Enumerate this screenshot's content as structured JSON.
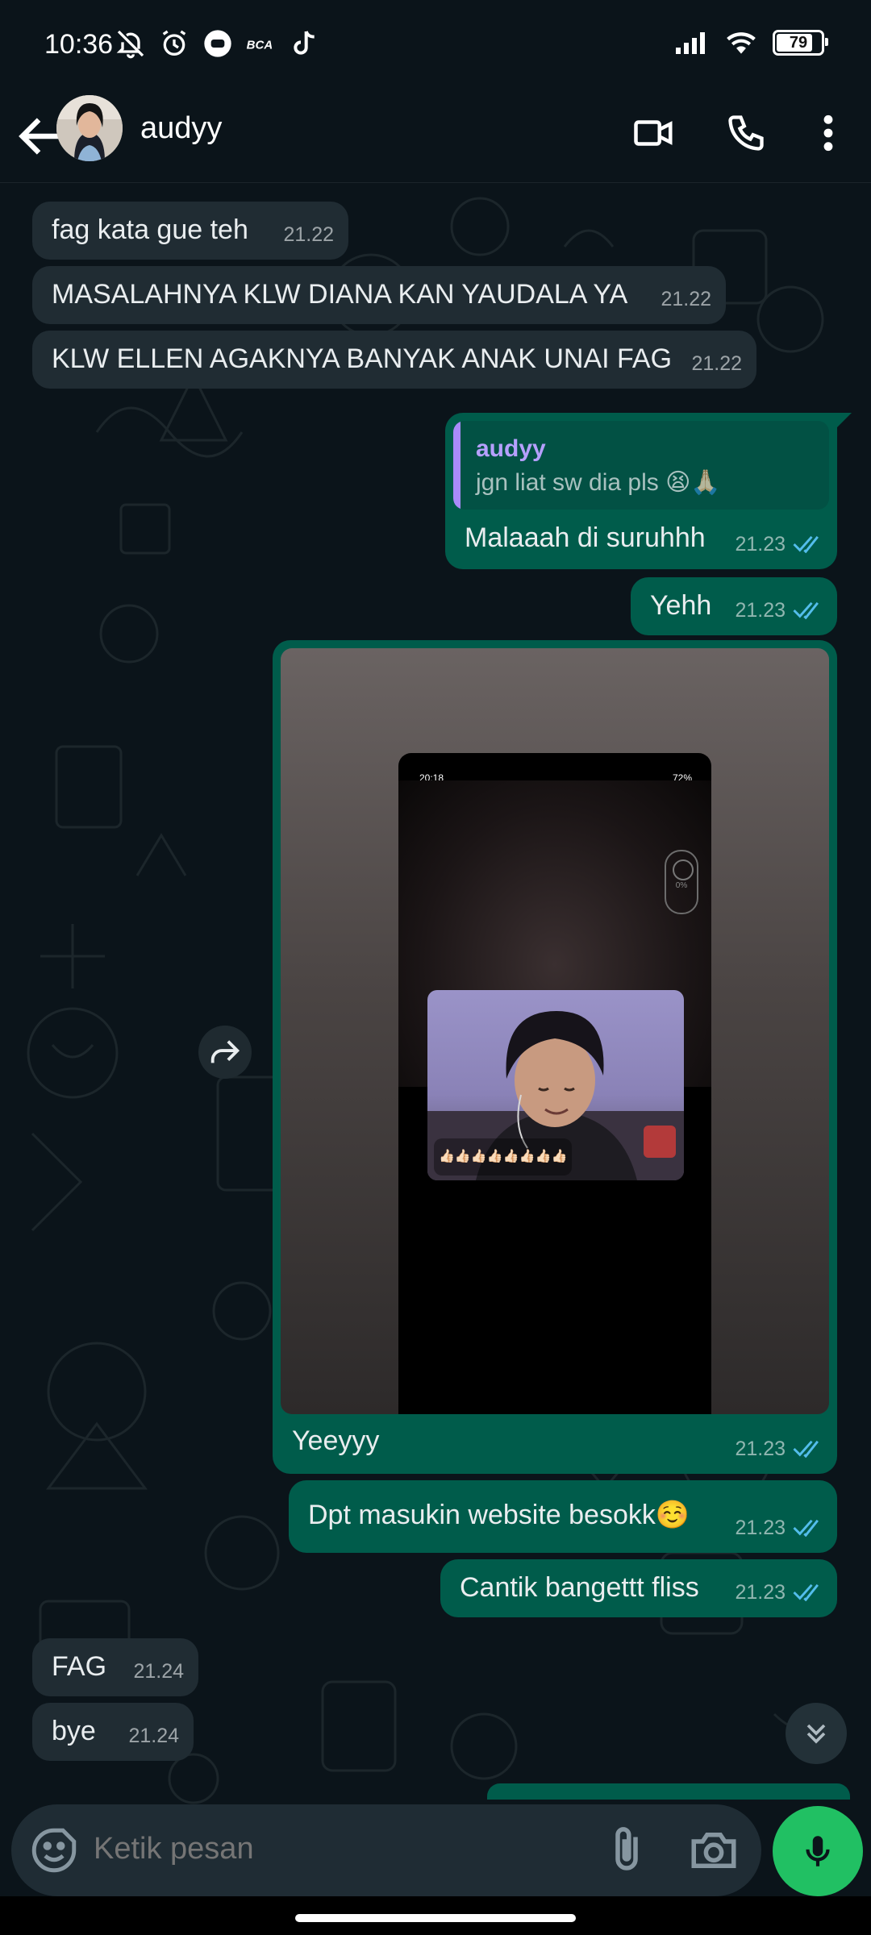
{
  "status_bar": {
    "time": "10:36",
    "battery": "79",
    "left_icons": [
      "bell-off-icon",
      "alarm-icon",
      "circle-chat-icon",
      "bca-icon",
      "tiktok-icon"
    ],
    "right_icons": [
      "signal-icon",
      "wifi-icon",
      "battery-icon"
    ]
  },
  "header": {
    "contact_name": "audyy",
    "actions": [
      "video-call-icon",
      "voice-call-icon",
      "more-options-icon"
    ]
  },
  "messages": [
    {
      "direction": "in",
      "text": "fag kata gue teh",
      "time": "21.22"
    },
    {
      "direction": "in",
      "text": "MASALAHNYA KLW DIANA KAN YAUDALA YA",
      "time": "21.22"
    },
    {
      "direction": "in",
      "text": "KLW ELLEN AGAKNYA BANYAK ANAK UNAI FAG",
      "time": "21.22"
    },
    {
      "direction": "out",
      "text": "Malaaah di suruhhh",
      "time": "21.23",
      "reply": {
        "name": "audyy",
        "text": "jgn liat sw dia pls 😫🙏🏻"
      }
    },
    {
      "direction": "out",
      "text": "Yehh",
      "time": "21.23"
    },
    {
      "direction": "out",
      "type": "image",
      "text": "Yeeyyy",
      "time": "21.23",
      "image": {
        "status_time": "20:18",
        "status_right": "72%",
        "zoom": "0%",
        "emoji_row": "👍🏻👍🏻👍🏻👍🏻👍🏻👍🏻👍🏻👍🏻"
      }
    },
    {
      "direction": "out",
      "text": "Dpt masukin website besokk☺️",
      "time": "21.23"
    },
    {
      "direction": "out",
      "text": "Cantik bangettt fliss",
      "time": "21.23"
    },
    {
      "direction": "in",
      "text": "FAG",
      "time": "21.24"
    },
    {
      "direction": "in",
      "text": "bye",
      "time": "21.24"
    }
  ],
  "input": {
    "placeholder": "Ketik pesan"
  },
  "colors": {
    "background": "#0b141a",
    "incoming": "#202c33",
    "outgoing": "#005c4b",
    "accent": "#21c063",
    "read_ticks": "#53bdeb"
  }
}
